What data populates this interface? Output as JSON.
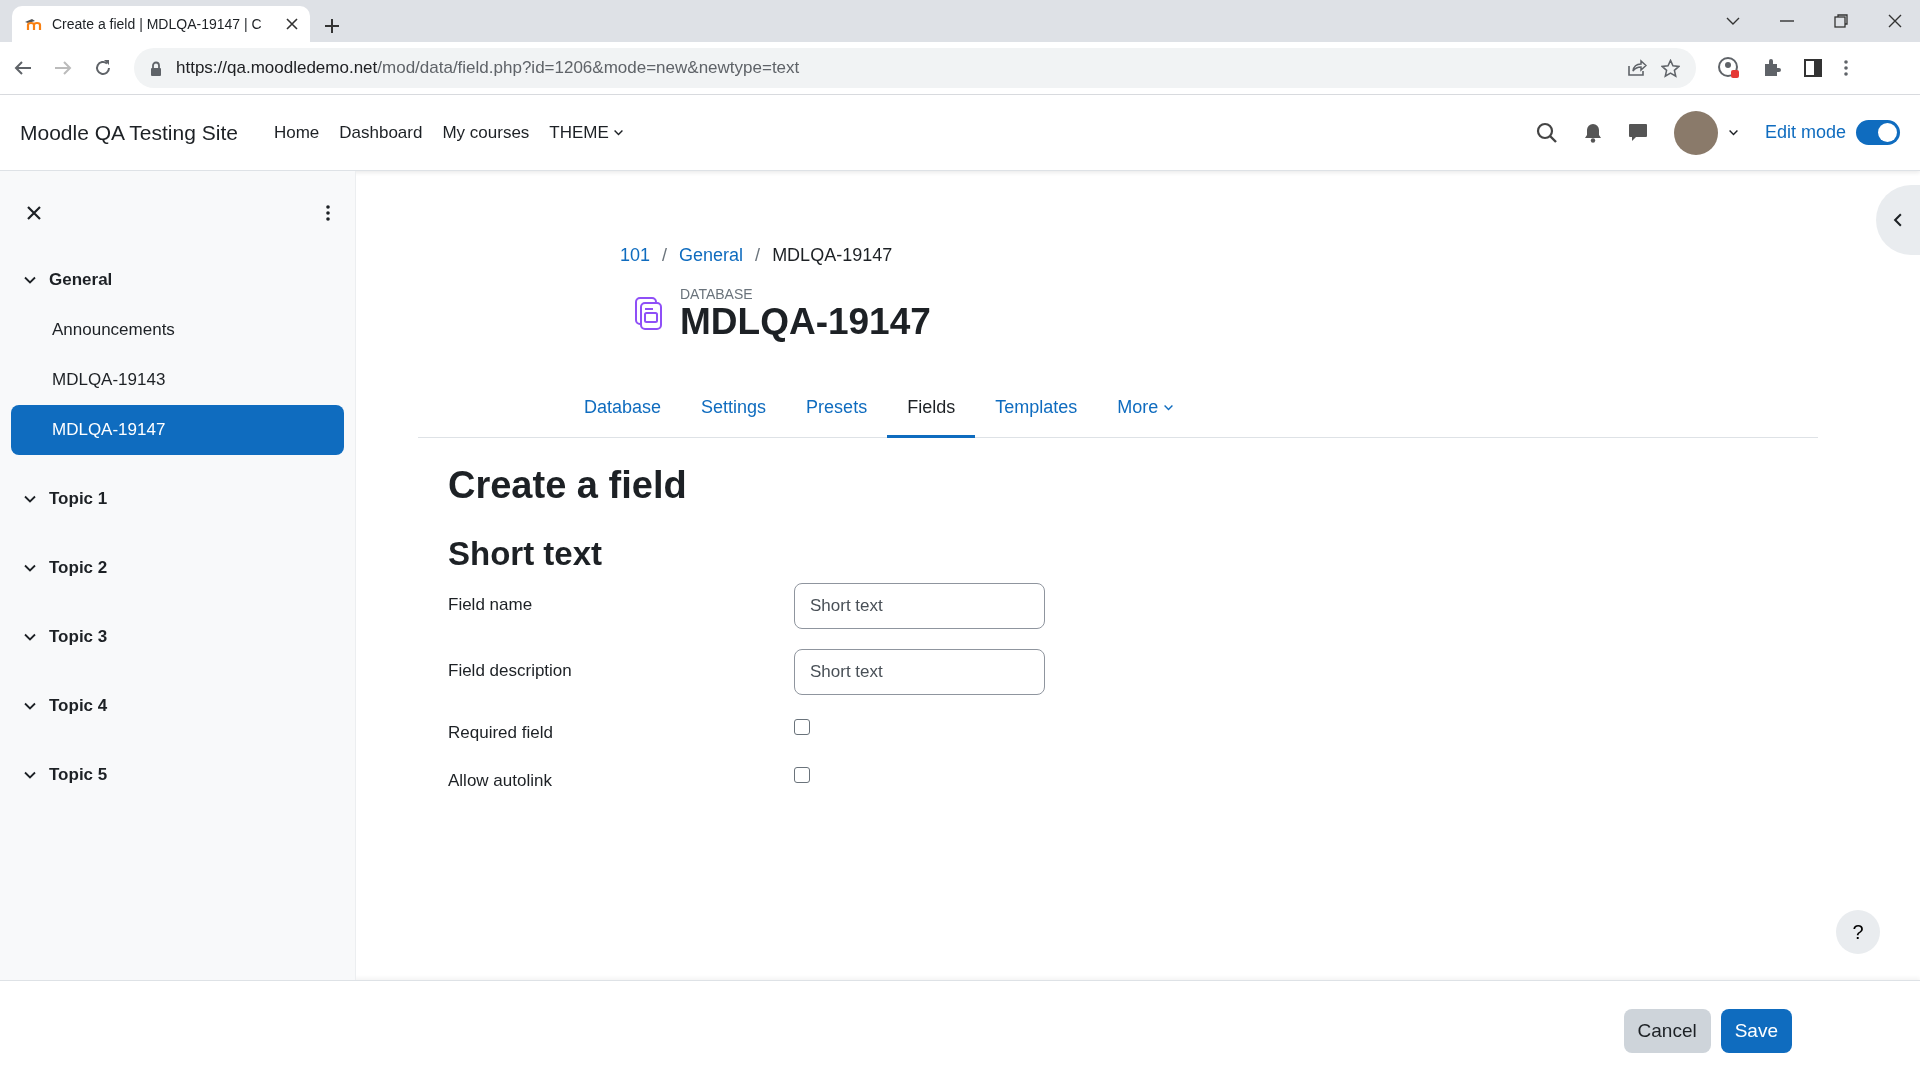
{
  "browser": {
    "tab_title": "Create a field | MDLQA-19147 | C",
    "url_host": "https://qa.moodledemo.net",
    "url_path": "/mod/data/field.php?id=1206&mode=new&newtype=text"
  },
  "navbar": {
    "site_name": "Moodle QA Testing Site",
    "links": [
      {
        "label": "Home",
        "kind": "link"
      },
      {
        "label": "Dashboard",
        "kind": "link"
      },
      {
        "label": "My courses",
        "kind": "link"
      },
      {
        "label": "THEME",
        "kind": "dropdown"
      }
    ],
    "edit_mode": {
      "label": "Edit mode",
      "on": true
    }
  },
  "sidebar": {
    "sections": [
      {
        "title": "General",
        "expanded": true,
        "children": [
          {
            "label": "Announcements",
            "selected": false
          },
          {
            "label": "MDLQA-19143",
            "selected": false
          },
          {
            "label": "MDLQA-19147",
            "selected": true
          }
        ]
      },
      {
        "title": "Topic 1",
        "expanded": true
      },
      {
        "title": "Topic 2",
        "expanded": true
      },
      {
        "title": "Topic 3",
        "expanded": true
      },
      {
        "title": "Topic 4",
        "expanded": true
      },
      {
        "title": "Topic 5",
        "expanded": true
      }
    ]
  },
  "breadcrumb_separator": "/",
  "breadcrumb": [
    {
      "label": "101",
      "kind": "link"
    },
    {
      "label": "General",
      "kind": "link"
    },
    {
      "label": "MDLQA-19147",
      "kind": "current"
    }
  ],
  "activity": {
    "type_label": "DATABASE",
    "title": "MDLQA-19147"
  },
  "tabs": [
    {
      "label": "Database",
      "selected": false,
      "kind": "link"
    },
    {
      "label": "Settings",
      "selected": false,
      "kind": "link"
    },
    {
      "label": "Presets",
      "selected": false,
      "kind": "link"
    },
    {
      "label": "Fields",
      "selected": true,
      "kind": "link"
    },
    {
      "label": "Templates",
      "selected": false,
      "kind": "link"
    },
    {
      "label": "More",
      "selected": false,
      "kind": "dropdown"
    }
  ],
  "heading": "Create a field",
  "section_heading": "Short text",
  "fields": [
    {
      "kind": "text",
      "label": "Field name",
      "value": "Short text"
    },
    {
      "kind": "text",
      "label": "Field description",
      "value": "Short text"
    },
    {
      "kind": "checkbox",
      "label": "Required field",
      "checked": false
    },
    {
      "kind": "checkbox",
      "label": "Allow autolink",
      "checked": false
    }
  ],
  "help": "?",
  "buttons": [
    {
      "label": "Cancel",
      "kind": "secondary"
    },
    {
      "label": "Save",
      "kind": "primary"
    }
  ]
}
